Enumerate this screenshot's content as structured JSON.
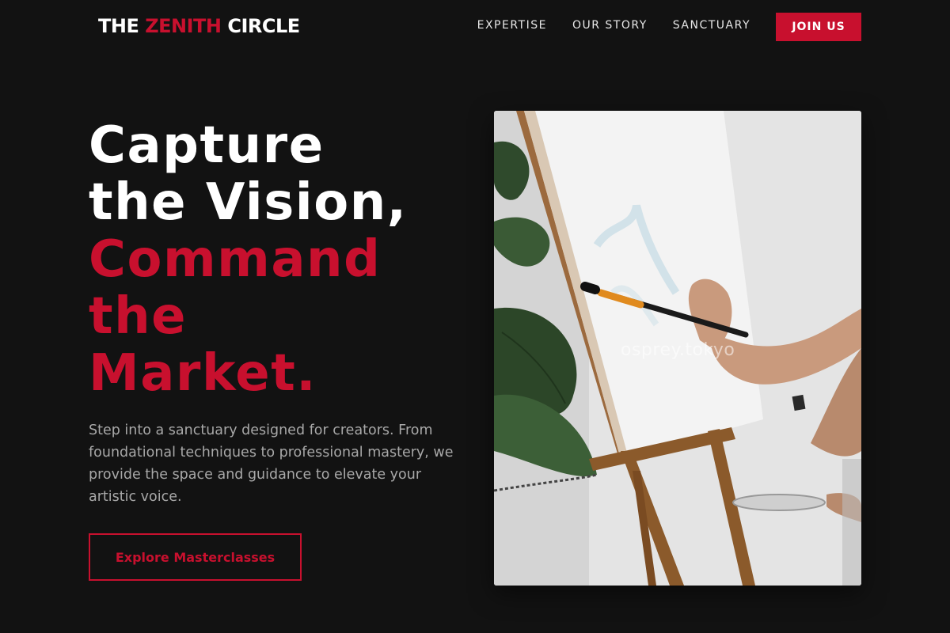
{
  "nav": {
    "logo": {
      "part1": "THE ",
      "accent": "ZENITH",
      "part2": " CIRCLE"
    },
    "links": [
      {
        "label": "EXPERTISE"
      },
      {
        "label": "OUR STORY"
      },
      {
        "label": "SANCTUARY"
      }
    ],
    "join_label": "JOIN US"
  },
  "hero": {
    "headline": {
      "white_line1": "Capture",
      "white_line2": "the Vision,",
      "red_line1": "Command",
      "red_line2": "the",
      "red_line3": "Market."
    },
    "description": "Step into a sanctuary designed for creators. From foundational techniques to professional mastery, we provide the space and guidance to elevate your artistic voice.",
    "cta_label": "Explore Masterclasses",
    "image_watermark": "osprey.tokyo"
  },
  "colors": {
    "background": "#121212",
    "accent": "#c8102e",
    "text": "#ffffff",
    "muted": "#a8a8a8"
  }
}
